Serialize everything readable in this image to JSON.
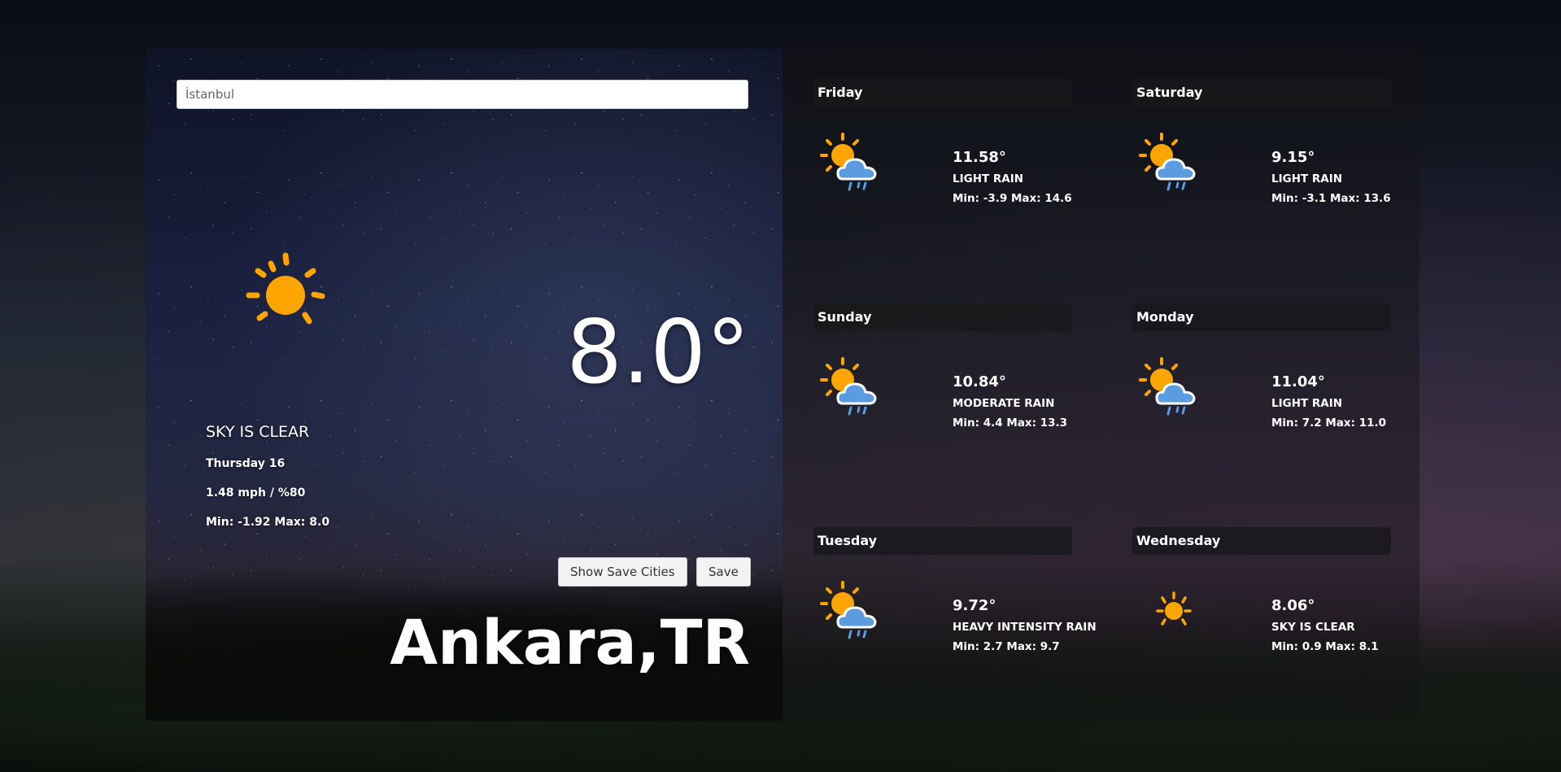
{
  "search": {
    "placeholder": "İstanbul"
  },
  "current": {
    "icon": "sun-icon",
    "temperature": "8.0°",
    "description": "SKY IS CLEAR",
    "date": "Thursday 16",
    "wind_humidity": "1.48 mph / %80",
    "min_max": "Min: -1.92 Max: 8.0",
    "city": "Ankara,TR"
  },
  "buttons": {
    "show_saved": "Show Save Cities",
    "save": "Save"
  },
  "forecast": [
    {
      "day": "Friday",
      "icon": "sun-cloud-rain-icon",
      "temp": "11.58°",
      "desc": "LIGHT RAIN",
      "min_max": "Min: -3.9 Max: 14.6"
    },
    {
      "day": "Saturday",
      "icon": "sun-cloud-rain-icon",
      "temp": "9.15°",
      "desc": "LIGHT RAIN",
      "min_max": "Min: -3.1 Max: 13.6"
    },
    {
      "day": "Sunday",
      "icon": "sun-cloud-rain-icon",
      "temp": "10.84°",
      "desc": "MODERATE RAIN",
      "min_max": "Min: 4.4 Max: 13.3"
    },
    {
      "day": "Monday",
      "icon": "sun-cloud-rain-icon",
      "temp": "11.04°",
      "desc": "LIGHT RAIN",
      "min_max": "Min: 7.2 Max: 11.0"
    },
    {
      "day": "Tuesday",
      "icon": "sun-cloud-rain-icon",
      "temp": "9.72°",
      "desc": "HEAVY INTENSITY RAIN",
      "min_max": "Min: 2.7 Max: 9.7"
    },
    {
      "day": "Wednesday",
      "icon": "sun-icon",
      "temp": "8.06°",
      "desc": "SKY IS CLEAR",
      "min_max": "Min: 0.9 Max: 8.1"
    }
  ],
  "colors": {
    "sun": "#FFA500",
    "cloud": "#5B9BE0",
    "rain": "#5B9BE0",
    "text": "#FFFFFF"
  }
}
